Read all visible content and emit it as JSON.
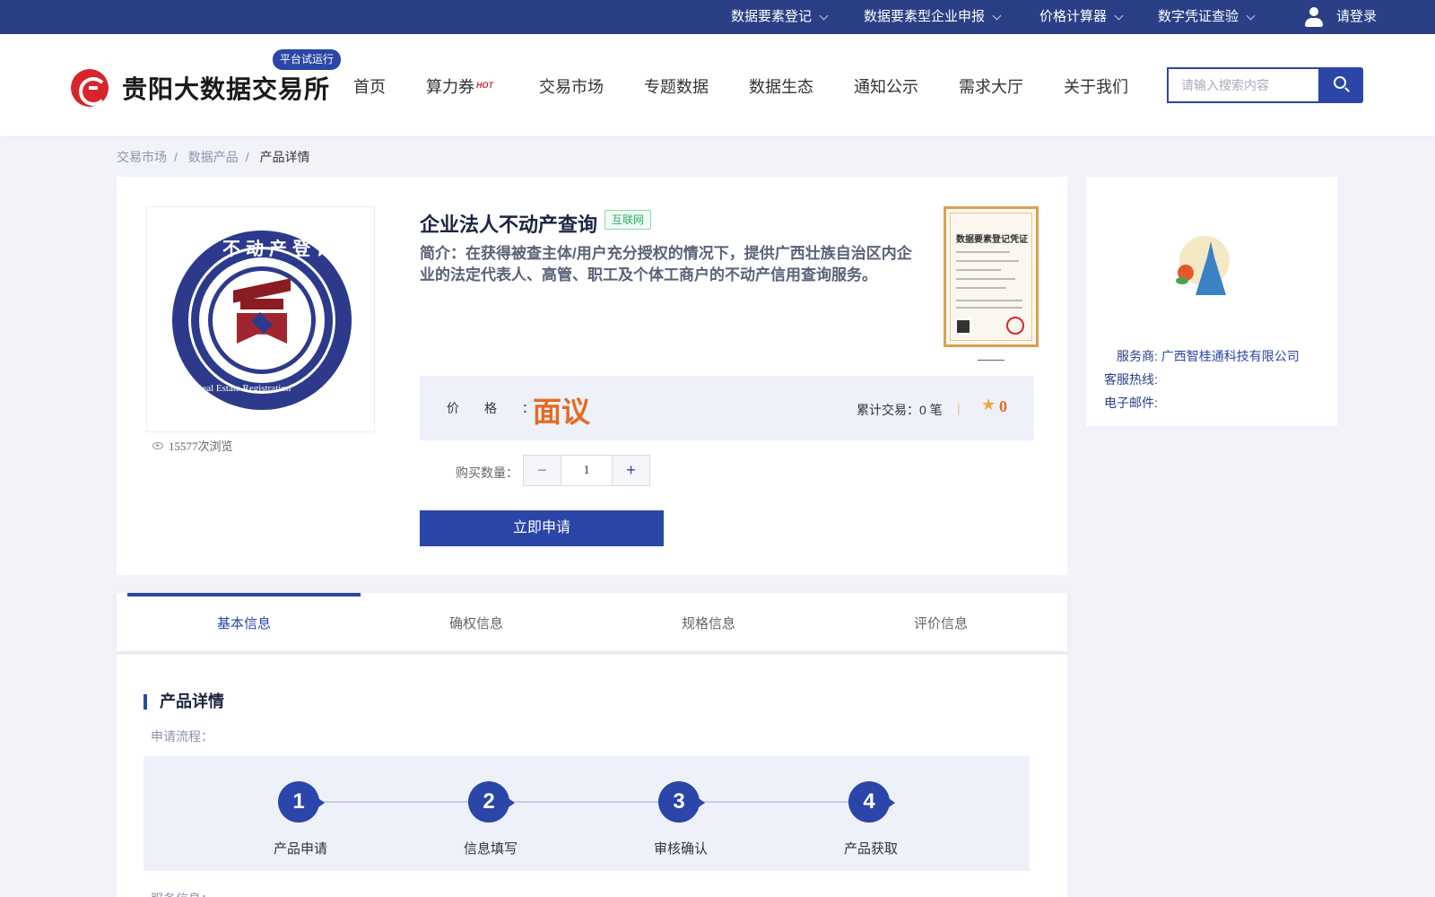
{
  "topbar": {
    "items": [
      {
        "label": "数据要素登记"
      },
      {
        "label": "数据要素型企业申报"
      },
      {
        "label": "价格计算器"
      },
      {
        "label": "数字凭证查验"
      }
    ],
    "login": "请登录"
  },
  "header": {
    "logo_text": "贵阳大数据交易所",
    "trial_badge": "平台试运行",
    "nav": [
      "首页",
      "算力券",
      "交易市场",
      "专题数据",
      "数据生态",
      "通知公示",
      "需求大厅",
      "关于我们"
    ],
    "hot_tag": "HOT",
    "search_placeholder": "请输入搜索内容"
  },
  "breadcrumb": [
    "交易市场",
    "数据产品",
    "产品详情"
  ],
  "product": {
    "title": "企业法人不动产查询",
    "tag": "互联网",
    "description": "简介：在获得被查主体/用户充分授权的情况下，提供广西壮族自治区内企业的法定代表人、高管、职工及个体工商户的不动产信用查询服务。",
    "image_text_top": "不动产登记",
    "image_text_bottom": "Real Estate Registration",
    "views": "15577次浏览",
    "certificate_title": "数据要素登记凭证",
    "price_label": "价格：",
    "price_value": "面议",
    "deals": "累计交易：0 笔",
    "rating": "0",
    "quantity_label": "购买数量：",
    "quantity": "1",
    "apply_button": "立即申请"
  },
  "provider": {
    "service_label": "服务商:",
    "service_name": "广西智桂通科技有限公司",
    "hotline_label": "客服热线:",
    "email_label": "电子邮件:"
  },
  "tabs": [
    "基本信息",
    "确权信息",
    "规格信息",
    "评价信息"
  ],
  "detail": {
    "section_title": "产品详情",
    "flow_label": "申请流程：",
    "steps": [
      {
        "num": "1",
        "label": "产品申请"
      },
      {
        "num": "2",
        "label": "信息填写"
      },
      {
        "num": "3",
        "label": "审核确认"
      },
      {
        "num": "4",
        "label": "产品获取"
      }
    ],
    "service_info_label": "服务信息："
  },
  "colors": {
    "primary": "#2b46a8",
    "topbar": "#2b3f86",
    "price": "#e56a1f",
    "logo_red": "#d7262b"
  }
}
